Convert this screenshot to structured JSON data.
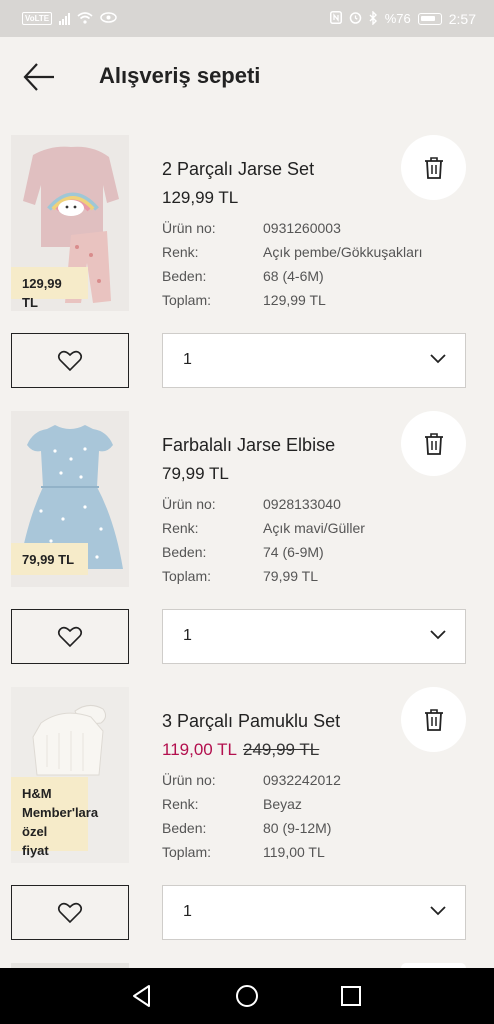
{
  "status": {
    "volte": "VoLTE",
    "battery": "%76",
    "time": "2:57"
  },
  "header": {
    "title": "Alışveriş sepeti"
  },
  "labels": {
    "article_no": "Ürün no:",
    "color": "Renk:",
    "size": "Beden:",
    "total": "Toplam:"
  },
  "items": [
    {
      "name": "2 Parçalı Jarse Set",
      "price": "129,99 TL",
      "badge": "129,99 TL",
      "article_no": "0931260003",
      "color": "Açık pembe/Gökkuşakları",
      "size": "68 (4-6M)",
      "total": "129,99 TL",
      "quantity": "1"
    },
    {
      "name": "Farbalalı Jarse Elbise",
      "price": "79,99 TL",
      "badge": "79,99 TL",
      "article_no": "0928133040",
      "color": "Açık mavi/Güller",
      "size": "74 (6-9M)",
      "total": "79,99 TL",
      "quantity": "1"
    },
    {
      "name": "3 Parçalı Pamuklu Set",
      "sale_price": "119,00 TL",
      "original_price": "249,99 TL",
      "badge_line1": "H&M",
      "badge_line2": "Member'lara",
      "badge_line3": "özel fiyat",
      "article_no": "0932242012",
      "color": "Beyaz",
      "size": "80 (9-12M)",
      "total": "119,00 TL",
      "quantity": "1"
    }
  ]
}
